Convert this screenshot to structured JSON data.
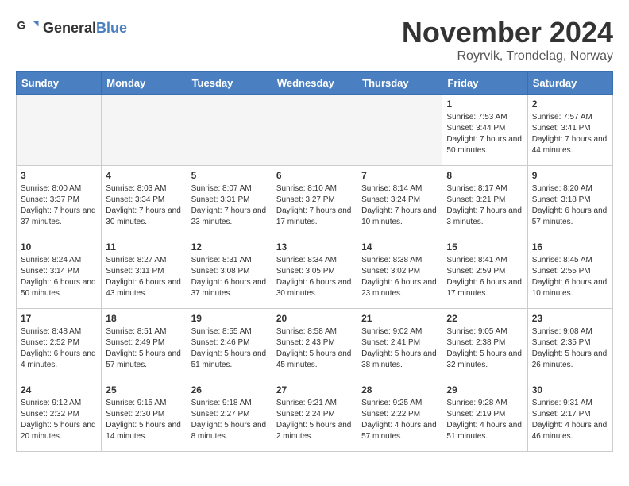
{
  "header": {
    "logo_general": "General",
    "logo_blue": "Blue",
    "title": "November 2024",
    "subtitle": "Royrvik, Trondelag, Norway"
  },
  "days_of_week": [
    "Sunday",
    "Monday",
    "Tuesday",
    "Wednesday",
    "Thursday",
    "Friday",
    "Saturday"
  ],
  "weeks": [
    [
      {
        "day": "",
        "empty": true
      },
      {
        "day": "",
        "empty": true
      },
      {
        "day": "",
        "empty": true
      },
      {
        "day": "",
        "empty": true
      },
      {
        "day": "",
        "empty": true
      },
      {
        "day": "1",
        "sunrise": "Sunrise: 7:53 AM",
        "sunset": "Sunset: 3:44 PM",
        "daylight": "Daylight: 7 hours and 50 minutes."
      },
      {
        "day": "2",
        "sunrise": "Sunrise: 7:57 AM",
        "sunset": "Sunset: 3:41 PM",
        "daylight": "Daylight: 7 hours and 44 minutes."
      }
    ],
    [
      {
        "day": "3",
        "sunrise": "Sunrise: 8:00 AM",
        "sunset": "Sunset: 3:37 PM",
        "daylight": "Daylight: 7 hours and 37 minutes."
      },
      {
        "day": "4",
        "sunrise": "Sunrise: 8:03 AM",
        "sunset": "Sunset: 3:34 PM",
        "daylight": "Daylight: 7 hours and 30 minutes."
      },
      {
        "day": "5",
        "sunrise": "Sunrise: 8:07 AM",
        "sunset": "Sunset: 3:31 PM",
        "daylight": "Daylight: 7 hours and 23 minutes."
      },
      {
        "day": "6",
        "sunrise": "Sunrise: 8:10 AM",
        "sunset": "Sunset: 3:27 PM",
        "daylight": "Daylight: 7 hours and 17 minutes."
      },
      {
        "day": "7",
        "sunrise": "Sunrise: 8:14 AM",
        "sunset": "Sunset: 3:24 PM",
        "daylight": "Daylight: 7 hours and 10 minutes."
      },
      {
        "day": "8",
        "sunrise": "Sunrise: 8:17 AM",
        "sunset": "Sunset: 3:21 PM",
        "daylight": "Daylight: 7 hours and 3 minutes."
      },
      {
        "day": "9",
        "sunrise": "Sunrise: 8:20 AM",
        "sunset": "Sunset: 3:18 PM",
        "daylight": "Daylight: 6 hours and 57 minutes."
      }
    ],
    [
      {
        "day": "10",
        "sunrise": "Sunrise: 8:24 AM",
        "sunset": "Sunset: 3:14 PM",
        "daylight": "Daylight: 6 hours and 50 minutes."
      },
      {
        "day": "11",
        "sunrise": "Sunrise: 8:27 AM",
        "sunset": "Sunset: 3:11 PM",
        "daylight": "Daylight: 6 hours and 43 minutes."
      },
      {
        "day": "12",
        "sunrise": "Sunrise: 8:31 AM",
        "sunset": "Sunset: 3:08 PM",
        "daylight": "Daylight: 6 hours and 37 minutes."
      },
      {
        "day": "13",
        "sunrise": "Sunrise: 8:34 AM",
        "sunset": "Sunset: 3:05 PM",
        "daylight": "Daylight: 6 hours and 30 minutes."
      },
      {
        "day": "14",
        "sunrise": "Sunrise: 8:38 AM",
        "sunset": "Sunset: 3:02 PM",
        "daylight": "Daylight: 6 hours and 23 minutes."
      },
      {
        "day": "15",
        "sunrise": "Sunrise: 8:41 AM",
        "sunset": "Sunset: 2:59 PM",
        "daylight": "Daylight: 6 hours and 17 minutes."
      },
      {
        "day": "16",
        "sunrise": "Sunrise: 8:45 AM",
        "sunset": "Sunset: 2:55 PM",
        "daylight": "Daylight: 6 hours and 10 minutes."
      }
    ],
    [
      {
        "day": "17",
        "sunrise": "Sunrise: 8:48 AM",
        "sunset": "Sunset: 2:52 PM",
        "daylight": "Daylight: 6 hours and 4 minutes."
      },
      {
        "day": "18",
        "sunrise": "Sunrise: 8:51 AM",
        "sunset": "Sunset: 2:49 PM",
        "daylight": "Daylight: 5 hours and 57 minutes."
      },
      {
        "day": "19",
        "sunrise": "Sunrise: 8:55 AM",
        "sunset": "Sunset: 2:46 PM",
        "daylight": "Daylight: 5 hours and 51 minutes."
      },
      {
        "day": "20",
        "sunrise": "Sunrise: 8:58 AM",
        "sunset": "Sunset: 2:43 PM",
        "daylight": "Daylight: 5 hours and 45 minutes."
      },
      {
        "day": "21",
        "sunrise": "Sunrise: 9:02 AM",
        "sunset": "Sunset: 2:41 PM",
        "daylight": "Daylight: 5 hours and 38 minutes."
      },
      {
        "day": "22",
        "sunrise": "Sunrise: 9:05 AM",
        "sunset": "Sunset: 2:38 PM",
        "daylight": "Daylight: 5 hours and 32 minutes."
      },
      {
        "day": "23",
        "sunrise": "Sunrise: 9:08 AM",
        "sunset": "Sunset: 2:35 PM",
        "daylight": "Daylight: 5 hours and 26 minutes."
      }
    ],
    [
      {
        "day": "24",
        "sunrise": "Sunrise: 9:12 AM",
        "sunset": "Sunset: 2:32 PM",
        "daylight": "Daylight: 5 hours and 20 minutes."
      },
      {
        "day": "25",
        "sunrise": "Sunrise: 9:15 AM",
        "sunset": "Sunset: 2:30 PM",
        "daylight": "Daylight: 5 hours and 14 minutes."
      },
      {
        "day": "26",
        "sunrise": "Sunrise: 9:18 AM",
        "sunset": "Sunset: 2:27 PM",
        "daylight": "Daylight: 5 hours and 8 minutes."
      },
      {
        "day": "27",
        "sunrise": "Sunrise: 9:21 AM",
        "sunset": "Sunset: 2:24 PM",
        "daylight": "Daylight: 5 hours and 2 minutes."
      },
      {
        "day": "28",
        "sunrise": "Sunrise: 9:25 AM",
        "sunset": "Sunset: 2:22 PM",
        "daylight": "Daylight: 4 hours and 57 minutes."
      },
      {
        "day": "29",
        "sunrise": "Sunrise: 9:28 AM",
        "sunset": "Sunset: 2:19 PM",
        "daylight": "Daylight: 4 hours and 51 minutes."
      },
      {
        "day": "30",
        "sunrise": "Sunrise: 9:31 AM",
        "sunset": "Sunset: 2:17 PM",
        "daylight": "Daylight: 4 hours and 46 minutes."
      }
    ]
  ]
}
